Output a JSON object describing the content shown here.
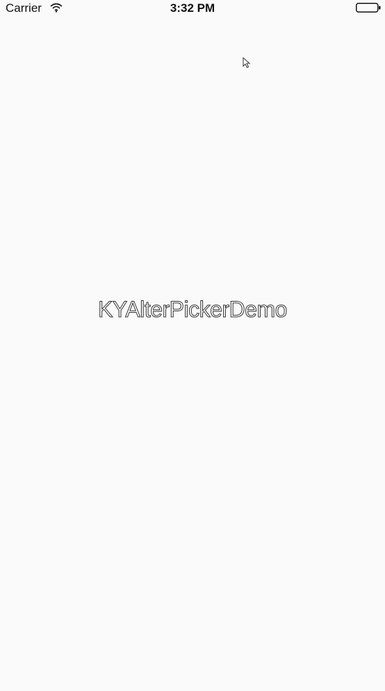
{
  "status_bar": {
    "carrier": "Carrier",
    "time": "3:32 PM",
    "wifi_icon": "wifi-icon",
    "battery_icon": "battery-icon"
  },
  "launch_screen": {
    "title": "KYAlterPickerDemo"
  },
  "colors": {
    "background": "#fafafa",
    "text": "#111111"
  }
}
